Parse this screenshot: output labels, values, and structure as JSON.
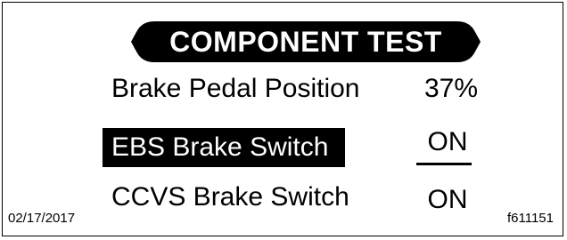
{
  "header": {
    "title": "COMPONENT TEST"
  },
  "rows": [
    {
      "label": "Brake Pedal Position",
      "value": "37%",
      "selected": false
    },
    {
      "label": "EBS Brake Switch",
      "value": "ON",
      "selected": true
    },
    {
      "label": "CCVS Brake Switch",
      "value": "ON",
      "selected": false
    }
  ],
  "footer": {
    "date": "02/17/2017",
    "figure_id": "f611151"
  },
  "colors": {
    "foreground": "#000000",
    "background": "#ffffff",
    "highlight_background": "#000000",
    "highlight_text": "#ffffff"
  }
}
